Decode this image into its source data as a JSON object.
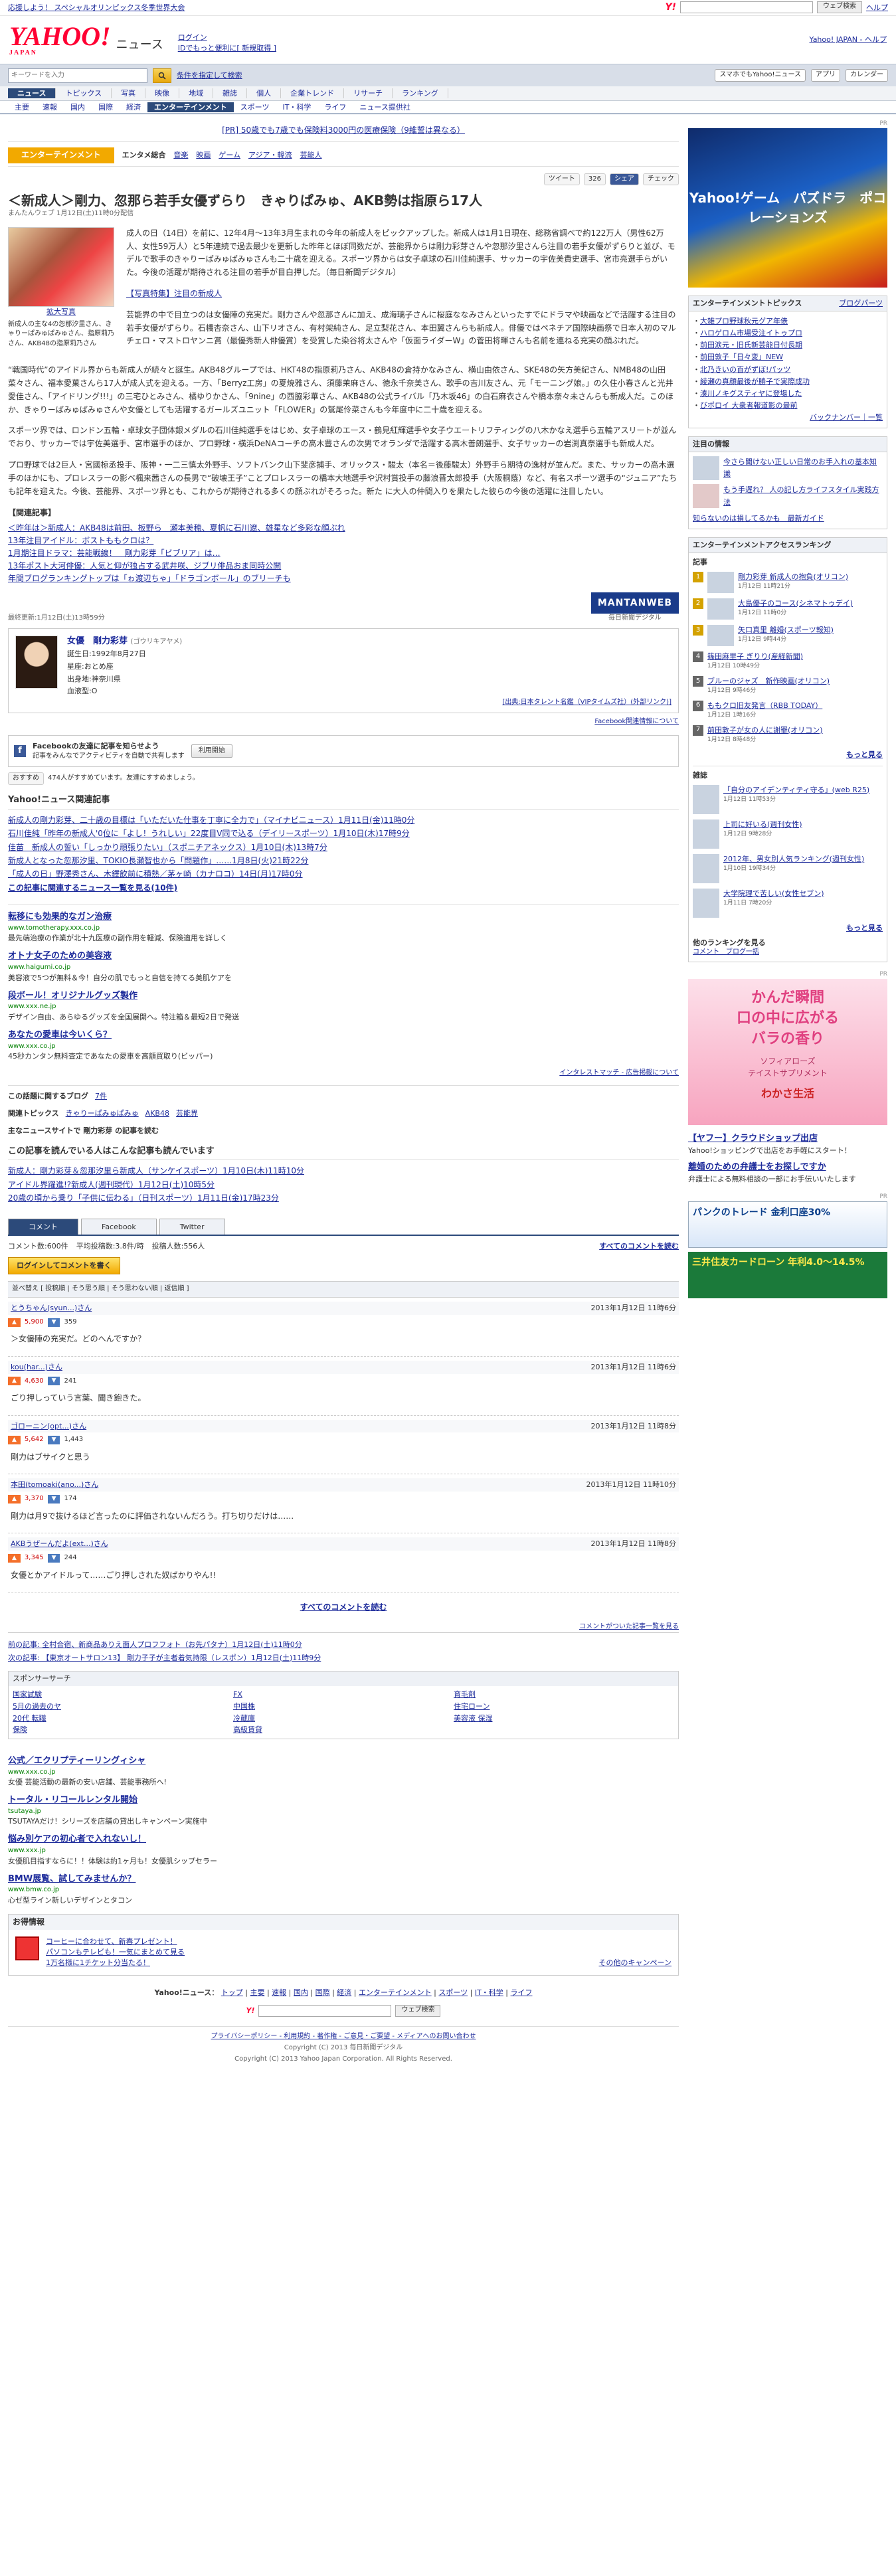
{
  "topbar": {
    "l1": "応援しよう！ スペシャルオリンピックス冬季世界大会",
    "help": "ヘルプ",
    "search_btn": "ウェブ検索"
  },
  "header": {
    "logo": "YAHOO!",
    "logo_sub": "JAPAN",
    "service": "ニュース",
    "login": "ログイン",
    "register": "IDでもっと便利に[ 新規取得 ]",
    "right": "Yahoo! JAPAN - ヘルプ"
  },
  "nav1": {
    "placeholder": "キーワードを入力",
    "adv": "条件を指定して検索",
    "sp": "スマホでもYahoo!ニュース",
    "app": "アプリ",
    "cal": "カレンダー"
  },
  "nav2": [
    "ニュース",
    "トピックス",
    "写真",
    "映像",
    "地域",
    "雑誌",
    "個人",
    "企業トレンド",
    "リサーチ",
    "ランキング"
  ],
  "nav3": [
    "主要",
    "速報",
    "国内",
    "国際",
    "経済",
    "エンターテインメント",
    "スポーツ",
    "IT・科学",
    "ライフ",
    "ニュース提供社"
  ],
  "ad_line": "[PR] 50歳でも7歳でも保険料3000円の医療保険（9維誓は異なる）",
  "cat": {
    "label": "エンターテインメント",
    "subs": [
      "エンタメ総合",
      "音楽",
      "映画",
      "ゲーム",
      "アジア・韓流",
      "芸能人"
    ]
  },
  "social": {
    "tweet": "ツイート",
    "tweet_count": "326",
    "share": "シェア",
    "check": "チェック"
  },
  "article": {
    "title": "＜新成人＞剛力、忽那ら若手女優ずらり　きゃりぱみゅ、AKB勢は指原ら17人",
    "meta": "まんたんウェブ 1月12日(土)11時0分配信",
    "fig_link": "拡大写真",
    "fig_cap": "新成人の主な4の忽那汐里さん、きゃりーぱみゅぱみゅさん、指原莉乃さん、AKB48の指原莉乃さん",
    "p1": "成人の日（14日）を前に、12年4月〜13年3月生まれの今年の新成人をピックアップした。新成人は1月1日現在、総務省調べで約122万人（男性62万人、女性59万人）と5年連続で過去最少を更新した昨年とほぼ同数だが、芸能界からは剛力彩芽さんや忽那汐里さんら注目の若手女優がずらりと並び、モデルで歌手のきゃりーぱみゅぱみゅさんも二十歳を迎える。スポーツ界からは女子卓球の石川佳純選手、サッカーの宇佐美貴史選手、宮市亮選手らがいた。今後の活躍が期待される注目の若手が目白押しだ。（毎日新聞デジタル）",
    "p1link": "【写真特集】注目の新成人",
    "p2": "芸能界の中で目立つのは女優陣の充実だ。剛力さんや忽那さんに加え、成海璃子さんに桜庭ななみさんといったすでにドラマや映画などで活躍する注目の若手女優がずらり。石橋杏奈さん、山下リオさん、有村架純さん、足立梨花さん、本田翼さんらも新成人。俳優ではペネチア国際映画祭で日本人初のマルチェロ・マストロヤンニ賞（最優秀新人俳優賞）を受賞した染谷将太さんや「仮面ライダーW」の菅田将暉さんも名前を連ねる充実の顔ぶれだ。",
    "p3": "“戦国時代”のアイドル界からも新成人が続々と誕生。AKB48グループでは、HKT48の指原莉乃さん、AKB48の倉持かなみさん、横山由依さん、SKE48の矢方美紀さん、NMB48の山田菜々さん、福本愛菓さんら17人が成人式を迎える。一方、「Berryz工房」の夏焼雅さん、須藤茉麻さん、徳永千奈美さん、歌手の吉川友さん、元「モーニング娘。」の久住小春さんと光井愛佳さん、「アイドリング!!!」の三宅ひとみさん、橘ゆりかさん、「9nine」の西脇彩華さん、AKB48の公式ライバル「乃木坂46」の白石麻衣さんや橋本奈々未さんらも新成人だ。このほか、きゃりーぱみゅぱみゅさんや女優としても活躍するガールズユニット「FLOWER」の鷲尾伶菜さんも今年度中に二十歳を迎える。",
    "p4": "スポーツ界では、ロンドン五輪・卓球女子団体銀メダルの石川佳純選手をはじめ、女子卓球のエース・鶴見紅輝選手や女子ウエートリフティングの八木かなえ選手ら五輪アスリートが並んでおり、サッカーでは宇佐美選手、宮市選手のほか、プロ野球・横浜DeNAコーチの高木豊さんの次男でオランダで活躍する高木善朗選手、女子サッカーの岩渕真奈選手も新成人だ。",
    "p5": "プロ野球では2巨人・宮國椋丞投手、阪神・一二三慎太外野手、ソフトバンク山下斐彦捕手、オリックス・駿太（本名＝後藤駿太）外野手ら期待の逸材が並んだ。また、サッカーの高木選手のほかにも、プロレスラーの影ベ楓来茜さんの長男で“破壊王子”ことプロレスラーの橋本大地選手や沢村賞投手の藤浪晋太郎投手（大阪桐蔭）など、有名スポーツ選手の“ジュニア”たちも記年を迎えた。今後、芸能界、スポーツ界とも、これからが期待される多くの顔ぶれがそろった。新た に大人の仲間入りを果たした彼らの今後の活躍に注目したい。",
    "rel_h": "【関連記事】",
    "rel": [
      "＜昨年は＞新成人：AKB48は前田、板野ら　瀬本美穂、夏帆に石川遼、雄星など多彩な顔ぶれ",
      "13年注目アイドル：ボストももクロは？",
      "1月期注目ドラマ：芸能戦線！　剛力彩芽「ビブリア」は…",
      "13年ポスト大河俳優：人気と仰が独占する武井咲、ジブリ俳品おま同時公開",
      "年間ブログランキングトップは「ゎ渡辺ちゃ」「ドラゴンボール」のブリーチも"
    ],
    "updated": "最終更新:1月12日(土)13時59分",
    "mantan": "MANTANWEB",
    "mantan_sub": "毎日新聞デジタル"
  },
  "profile": {
    "name": "女優　剛力彩芽",
    "kana": "(ゴウリキアヤメ)",
    "born": "誕生日:1992年8月27日",
    "sign": "星座:おとめ座",
    "from": "出身地:神奈川県",
    "blood": "血液型:O",
    "src": "[出典:日本タレント名鑑（VIPタイムズ社）(外部リンク)]"
  },
  "fb": {
    "text": "Facebookの友達に記事を知らせよう",
    "sub": "記事をみんなでアクティビティを自動で共有します",
    "btn": "利用開始",
    "note": "Facebook関連情報について",
    "like": "おすすめ",
    "likes": "474人がすすめています。友達にすすめましょう。"
  },
  "related": {
    "h": "Yahoo!ニュース関連記事",
    "items": [
      "新成人の剛力彩芽、二十歳の目標は「いただいた仕事を丁寧に全力で」（マイナビニュース）1月11日(金)11時0分",
      "石川佳純「昨年の新成人'0位に「よし！うれしい」22度目V同で込る（デイリースポーツ）1月10日(木)17時9分",
      "佳苗　新成人の誓い「しっかり頑張りたい」（スポニチアネックス）1月10日(木)13時7分",
      "新成人となった忽那汐里、TOKIO長瀬智也から「問題作」……1月8日(火)21時22分",
      "「成人の日」野澤秀さん、木鐸飲前に積熱／茅ヶ崎（カナロコ）14日(月)17時0分"
    ],
    "more": "この記事に関連するニュース一覧を見る(10件)"
  },
  "ads": {
    "items": [
      {
        "t": "転移にも効果的なガン治療",
        "u": "www.tomotherapy.xxx.co.jp",
        "d": "最先端治療の作業が北十九医療の副作用を軽減、保険適用を詳しく"
      },
      {
        "t": "オトナ女子のための美容液",
        "u": "www.haigumi.co.jp",
        "d": "美容液で5つが無料＆今！自分の肌でもっと自信を持てる美肌ケアを"
      },
      {
        "t": "段ボール！オリジナルグッズ製作",
        "u": "www.xxx.ne.jp",
        "d": "デザイン自由、あらゆるグッズを全国展開へ。特注箱＆最短2日で発送"
      },
      {
        "t": "あなたの愛車は今いくら？",
        "u": "www.xxx.co.jp",
        "d": "45秒カンタン無料査定であなたの愛車を高額買取り(ビッパー)"
      }
    ],
    "inter": "インタレストマッチ - 広告掲載について"
  },
  "tags": {
    "h": "関連トピックス",
    "items": [
      "きゃりーぱみゅぱみゅ",
      "AKB48",
      "芸能界"
    ],
    "blog": "この話題に関するブログ",
    "blog_n": "7件",
    "staff": "主なニュースサイトで 剛力彩芽 の記事を読む"
  },
  "reads": {
    "h": "この記事を読んでいる人はこんな記事も読んでいます",
    "items": [
      "新成人：剛力彩芽＆忽那汐里ら新成人（サンケイスポーツ）1月10日(木)11時10分",
      "アイドル界躍進!?新成人(週刊現代）1月12日(土)10時5分",
      "20歳の頃から乗り「子供に伝わる」（日刊スポーツ）1月11日(金)17時23分"
    ]
  },
  "comments": {
    "tabs": [
      "コメント",
      "Facebook",
      "Twitter"
    ],
    "total": "コメント数:600件",
    "avg": "平均投稿数:3.8件/時",
    "ppl": "投稿人数:556人",
    "see": "すべてのコメントを読む",
    "post": "ログインしてコメントを書く",
    "sort": "並べ替え [ 投稿順 | そう思う順 | そう思わない順 | 返信順 ]",
    "items": [
      {
        "user": "とうちゃん(syun...)さん",
        "date": "2013年1月12日 11時6分",
        "good": "5,900",
        "bad": "359",
        "text": "＞女優陣の充実だ。どのへんですか？"
      },
      {
        "user": "kou(har...)さん",
        "date": "2013年1月12日 11時6分",
        "good": "4,630",
        "bad": "241",
        "text": "ごり押しっていう言葉、聞き飽きた。"
      },
      {
        "user": "ゴローニン(opt...)さん",
        "date": "2013年1月12日 11時8分",
        "good": "5,642",
        "bad": "1,443",
        "text": "剛力はブサイクと思う"
      },
      {
        "user": "本田(tomoaki(ano...)さん",
        "date": "2013年1月12日 11時10分",
        "good": "3,370",
        "bad": "174",
        "text": "剛力は月9で抜けるほど言ったのに評価されないんだろう。打ち切りだけは……"
      },
      {
        "user": "AKBうぜーんだよ(ext...)さん",
        "date": "2013年1月12日 11時8分",
        "good": "3,345",
        "bad": "244",
        "text": "女優とかアイドルって……ごり押しされた奴ばかりやん!!"
      }
    ],
    "see2": "すべてのコメントを読む",
    "back": "コメントがついた記事一覧を見る"
  },
  "prevnext": {
    "prev": "前の記事: 全村合宿、新商品ありえ面人プロフフォト（お先パタナ）1月12日(土)11時0分",
    "next": "次の記事: 【東京オートサロン13】 剛力子子が主者着気持限（レスポン）1月12日(土)11時9分"
  },
  "sponsor": {
    "h": "スポンサーサーチ",
    "items": [
      "国家試験",
      "FX",
      "育毛剤",
      "5月の過去のヤ",
      "中国株",
      "住宅ローン",
      "20代 転職",
      "冷蔵庫",
      "美容液 保湿",
      "保険",
      "高級賃貸"
    ]
  },
  "ads2": {
    "items": [
      {
        "t": "公式／エクリプティーリングィシャ",
        "u": "www.xxx.co.jp",
        "d": "女優 芸能活動の最新の安い店舗、芸能事務所へ!"
      },
      {
        "t": "トータル・リコールレンタル開始",
        "u": "tsutaya.jp",
        "d": "TSUTAYAだけ！シリーズを店舗の貸出しキャンペーン実施中"
      },
      {
        "t": "悩み別ケアの初心者で入れないし！",
        "u": "www.xxx.jp",
        "d": "女優肌目指すならに！！体験は約1ヶ月も！女優肌シップセラー"
      },
      {
        "t": "BMW展覧、試してみませんか？",
        "u": "www.bmw.co.jp",
        "d": "心ゼ型ライン新しいデザインとタコン"
      }
    ]
  },
  "otoku": {
    "h": "お得情報",
    "l1": "コーヒーに合わせて、新春プレゼント！",
    "l2": "パソコンもテレビも！一気にまとめて見る",
    "l3": "1万名様に1チケット分当たる！",
    "more": "その他のキャンペーン"
  },
  "footnav": [
    "Yahoo!ニュース",
    "トップ",
    "主要",
    "速報",
    "国内",
    "国際",
    "経済",
    "エンターテインメント",
    "スポーツ",
    "IT・科学",
    "ライフ"
  ],
  "foot": {
    "links": "プライバシーポリシー - 利用規約 - 著作権 - ご意見・ご要望 - メディアへのお問い合わせ",
    "c1": "Copyright (C) 2013 Yahoo Japan Corporation. All Rights Reserved.",
    "c2": "Copyright (C) 2013 毎日新聞デジタル"
  },
  "right": {
    "pr": "PR",
    "game_ad": "Yahoo!ゲーム　パズドラ　ポコレーションズ",
    "topics_h": "エンターテインメントトピックス",
    "topics_more": "ブログパーツ",
    "topics": [
      "大雑プロ野球秋元グア年俵",
      "ハロゲロム市場受注イトゥプロ",
      "前田涙元・旧氏新芸能日付長期",
      "前田敦子「日々変」NEW",
      "北乃きいの百がずぼ!パッツ",
      "綾瀬の真顔最後が勝子で実際成功",
      "湊川ノキグスティヤに登場した",
      "びポロイ 大衆者報道影の最前"
    ],
    "topics_link": "バックナンバー｜一覧",
    "notice_h": "注目の情報",
    "n1": "今さら聞けない正しい日常のお手入れの基本知識",
    "n2": "もう手遅れ？ 人の記し方ライフスタイル実践方法",
    "n3": "知らないのは損してるかも　最新ガイド",
    "rank_h": "エンターテインメントアクセスランキング",
    "rank_sub": "記事",
    "rank": [
      {
        "n": "1",
        "t": "剛力彩芽 新成人の抱負(オリコン)",
        "d": "1月12日 11時21分"
      },
      {
        "n": "2",
        "t": "大島優子のコース(シネマトゥデイ)",
        "d": "1月12日 11時0分"
      },
      {
        "n": "3",
        "t": "矢口真里 離婚(スポーツ報知)",
        "d": "1月12日 9時44分"
      },
      {
        "n": "4",
        "t": "篠田麻里子 ぎりり(産経新聞)",
        "d": "1月12日 10時49分"
      },
      {
        "n": "5",
        "t": "ブルーのジャズ　新作映画(オリコン)",
        "d": "1月12日 9時46分"
      },
      {
        "n": "6",
        "t": "ももクロ旧友発言（RBB TODAY）",
        "d": "1月12日 1時16分"
      },
      {
        "n": "7",
        "t": "前田敦子が女の人に謝罪(オリコン)",
        "d": "1月12日 8時48分"
      }
    ],
    "rank_more": "もっと見る",
    "mag_h": "雑誌",
    "mag": [
      {
        "t": "「自分のアイデンティティ守る」(web R25)",
        "d": "1月12日 11時53分"
      },
      {
        "t": "上司に好いる(週刊女性)",
        "d": "1月12日 9時28分"
      },
      {
        "t": "2012年、男女別人気ランキング(週刊女性)",
        "d": "1月10日 19時34分"
      },
      {
        "t": "大学院理で苦しい(女性セブン)",
        "d": "1月11日 7時20分"
      }
    ],
    "mag_more": "もっと見る",
    "other": "他のランキングを見る",
    "other_links": "コメント　ブログ一括",
    "pink": "かんだ瞬間\n口の中に広がる\nバラの香り",
    "pink_sub": "ソフィアローズ\nテイストサプリメント",
    "pink_brand": "わかさ生活",
    "yc": "【ヤフー】クラウドショップ出店",
    "yc_d": "Yahoo!ショッピングで出店をお手軽にスタート！",
    "ad2_t": "離婚のための弁護士をお探しですか",
    "ad2_d": "弁護士による無料相談の一部にお手伝いいたします",
    "bank": "パンクのトレード 金利口座30%",
    "card": "三井住友カードローン 年利4.0〜14.5%"
  }
}
